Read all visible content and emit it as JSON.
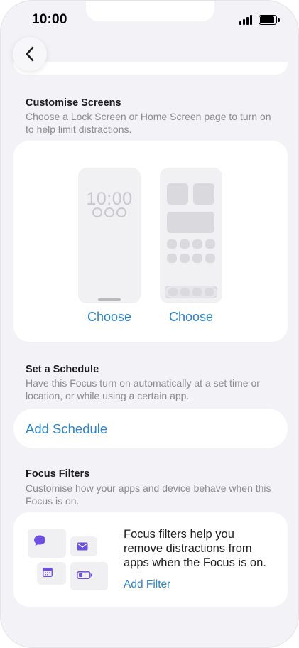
{
  "status_bar": {
    "time": "10:00"
  },
  "customise": {
    "title": "Customise Screens",
    "description": "Choose a Lock Screen or Home Screen page to turn on to help limit distractions.",
    "lock_preview_time": "10:00",
    "lock_choose_label": "Choose",
    "home_choose_label": "Choose"
  },
  "schedule": {
    "title": "Set a Schedule",
    "description": "Have this Focus turn on automatically at a set time or location, or while using a certain app.",
    "add_label": "Add Schedule"
  },
  "filters": {
    "title": "Focus Filters",
    "description": "Customise how your apps and device behave when this Focus is on.",
    "info_text": "Focus filters help you remove distractions from apps when the Focus is on.",
    "add_label": "Add Filter"
  },
  "colors": {
    "accent": "#2A84C8",
    "icon_purple": "#6E4FE0",
    "background": "#F2F2F7"
  }
}
